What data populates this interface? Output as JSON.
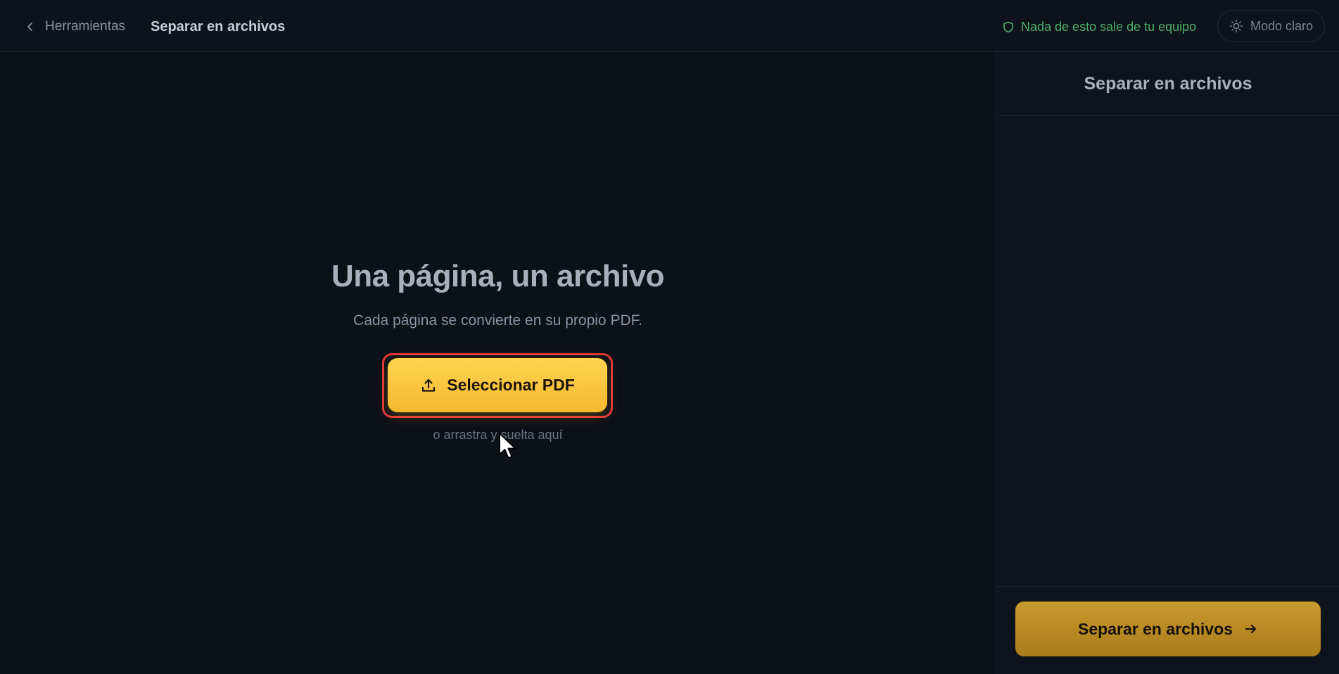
{
  "header": {
    "back_label": "Herramientas",
    "title": "Separar en archivos",
    "privacy_text": "Nada de esto sale de tu equipo",
    "mode_label": "Modo claro"
  },
  "main": {
    "heading": "Una página, un archivo",
    "subheading": "Cada página se convierte en su propio PDF.",
    "select_button_label": "Seleccionar PDF",
    "drop_hint": "o arrastra y suelta aquí"
  },
  "sidebar": {
    "title": "Separar en archivos",
    "action_button_label": "Separar en archivos"
  },
  "colors": {
    "accent": "#f6b82e",
    "privacy_green": "#4caf6a",
    "highlight_ring": "#e0373a"
  },
  "icons": {
    "back": "chevron-left-icon",
    "privacy": "shield-icon",
    "mode": "sun-icon",
    "upload": "upload-icon",
    "action": "arrow-right-icon"
  }
}
